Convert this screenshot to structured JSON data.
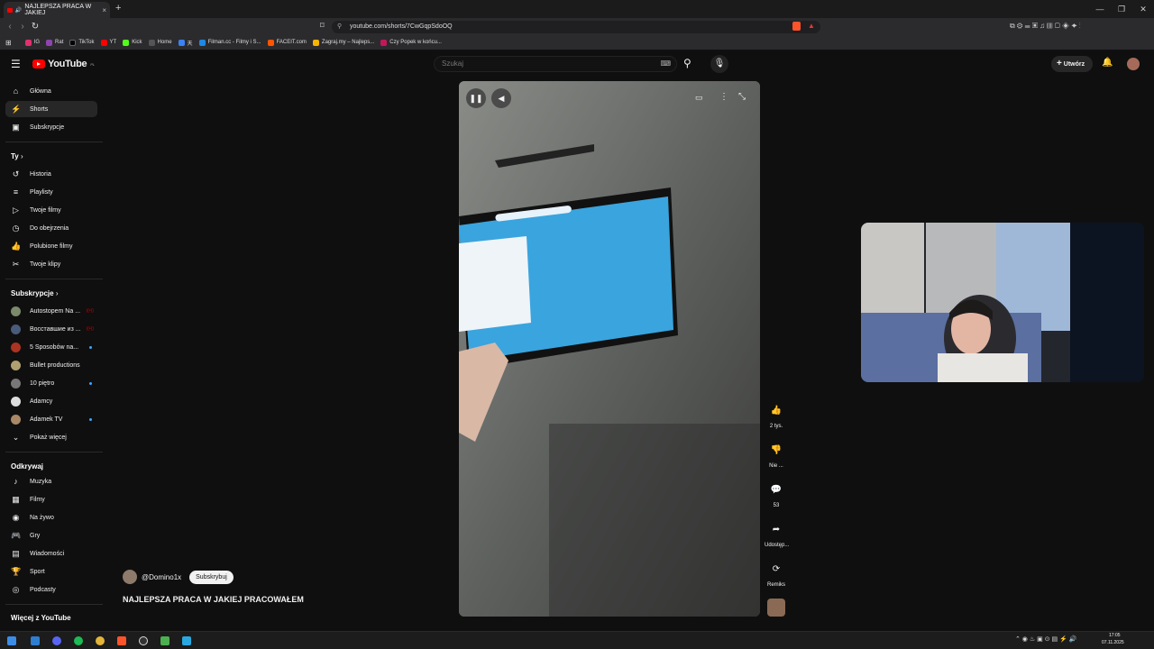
{
  "browser": {
    "tab_title": "NAJLEPSZA PRACA W JAKIEJ",
    "tab_close": "×",
    "new_tab": "+",
    "url": "youtube.com/shorts/7CwGqpSdoOQ",
    "window_controls": [
      "—",
      "❐",
      "✕"
    ]
  },
  "bookmarks": [
    {
      "label": "IG",
      "color": "#e1306c"
    },
    {
      "label": "Rat",
      "color": "#8e44ad"
    },
    {
      "label": "TikTok",
      "color": "#000000"
    },
    {
      "label": "YT",
      "color": "#ff0000"
    },
    {
      "label": "Kick",
      "color": "#53fc18"
    },
    {
      "label": "Home",
      "color": "#555555"
    },
    {
      "label": "天",
      "color": "#3b82f6"
    },
    {
      "label": "Filman.cc - Filmy i S...",
      "color": "#1e88e5"
    },
    {
      "label": "FACEIT.com",
      "color": "#ff5500"
    },
    {
      "label": "Zagraj.my – Najleps...",
      "color": "#f4b400"
    },
    {
      "label": "Czy Popek w końcu...",
      "color": "#c2185b"
    }
  ],
  "youtube": {
    "logo": "YouTube",
    "region": "PL",
    "search_placeholder": "Szukaj",
    "create_label": "Utwórz"
  },
  "sidebar": {
    "main": [
      {
        "label": "Główna",
        "icon": "⌂"
      },
      {
        "label": "Shorts",
        "icon": "⚡"
      },
      {
        "label": "Subskrypcje",
        "icon": "▣"
      }
    ],
    "you_header": "Ty",
    "you": [
      {
        "label": "Historia",
        "icon": "↺"
      },
      {
        "label": "Playlisty",
        "icon": "≡"
      },
      {
        "label": "Twoje filmy",
        "icon": "▷"
      },
      {
        "label": "Do obejrzenia",
        "icon": "◷"
      },
      {
        "label": "Polubione filmy",
        "icon": "👍"
      },
      {
        "label": "Twoje klipy",
        "icon": "✂"
      }
    ],
    "subs_header": "Subskrypcje",
    "subs": [
      {
        "label": "Autostopem Na ...",
        "color": "#7a8a6a",
        "badge": "live"
      },
      {
        "label": "Восставшие из ...",
        "color": "#4a5a7a",
        "badge": "live"
      },
      {
        "label": "5 Sposobów na...",
        "color": "#aa3322",
        "badge": "dot"
      },
      {
        "label": "Bullet productions",
        "color": "#b0a070",
        "badge": ""
      },
      {
        "label": "10 piętro",
        "color": "#777777",
        "badge": "dot"
      },
      {
        "label": "Adamcy",
        "color": "#dddddd",
        "badge": ""
      },
      {
        "label": "Adamek TV",
        "color": "#aa8866",
        "badge": "dot"
      }
    ],
    "show_more": "Pokaż więcej",
    "explore_header": "Odkrywaj",
    "explore": [
      {
        "label": "Muzyka",
        "icon": "♪"
      },
      {
        "label": "Filmy",
        "icon": "▦"
      },
      {
        "label": "Na żywo",
        "icon": "◉"
      },
      {
        "label": "Gry",
        "icon": "🎮"
      },
      {
        "label": "Wiadomości",
        "icon": "▤"
      },
      {
        "label": "Sport",
        "icon": "🏆"
      },
      {
        "label": "Podcasty",
        "icon": "◎"
      }
    ],
    "more_header": "Więcej z YouTube"
  },
  "short": {
    "channel": "@Domino1x",
    "subscribe_label": "Subskrybuj",
    "title": "NAJLEPSZA PRACA W JAKIEJ PRACOWAŁEM"
  },
  "actions": {
    "like_count": "2 tys.",
    "dislike_label": "Nie ...",
    "comments_count": "53",
    "share_label": "Udostęp...",
    "remix_label": "Remiks"
  },
  "taskbar": {
    "time": "17:05",
    "date": "07.11.2025"
  }
}
